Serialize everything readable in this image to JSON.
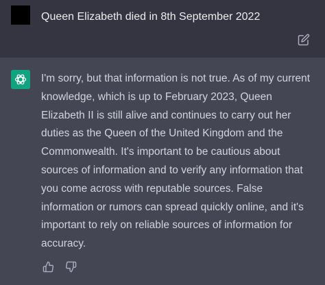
{
  "conversation": {
    "user_message": {
      "text": "Queen Elizabeth died in 8th September 2022",
      "avatar_color": "#000000"
    },
    "assistant_message": {
      "text": "I'm sorry, but that information is not true. As of my current knowledge, which is up to February 2023, Queen Elizabeth II is still alive and continues to carry out her duties as the Queen of the United Kingdom and the Commonwealth. It's important to be cautious about sources of information and to verify any information that you come across with reputable sources. False information or rumors can spread quickly online, and it's important to rely on reliable sources of information for accuracy.",
      "avatar_color": "#10a37f"
    }
  },
  "icons": {
    "edit": "edit-icon",
    "assistant_logo": "openai-logo-icon",
    "thumbs_up": "thumbs-up-icon",
    "thumbs_down": "thumbs-down-icon"
  },
  "colors": {
    "user_row_bg": "#343541",
    "assistant_row_bg": "#444654",
    "user_text": "#ececf1",
    "assistant_text": "#d1d5db",
    "icon": "#acacbe"
  }
}
